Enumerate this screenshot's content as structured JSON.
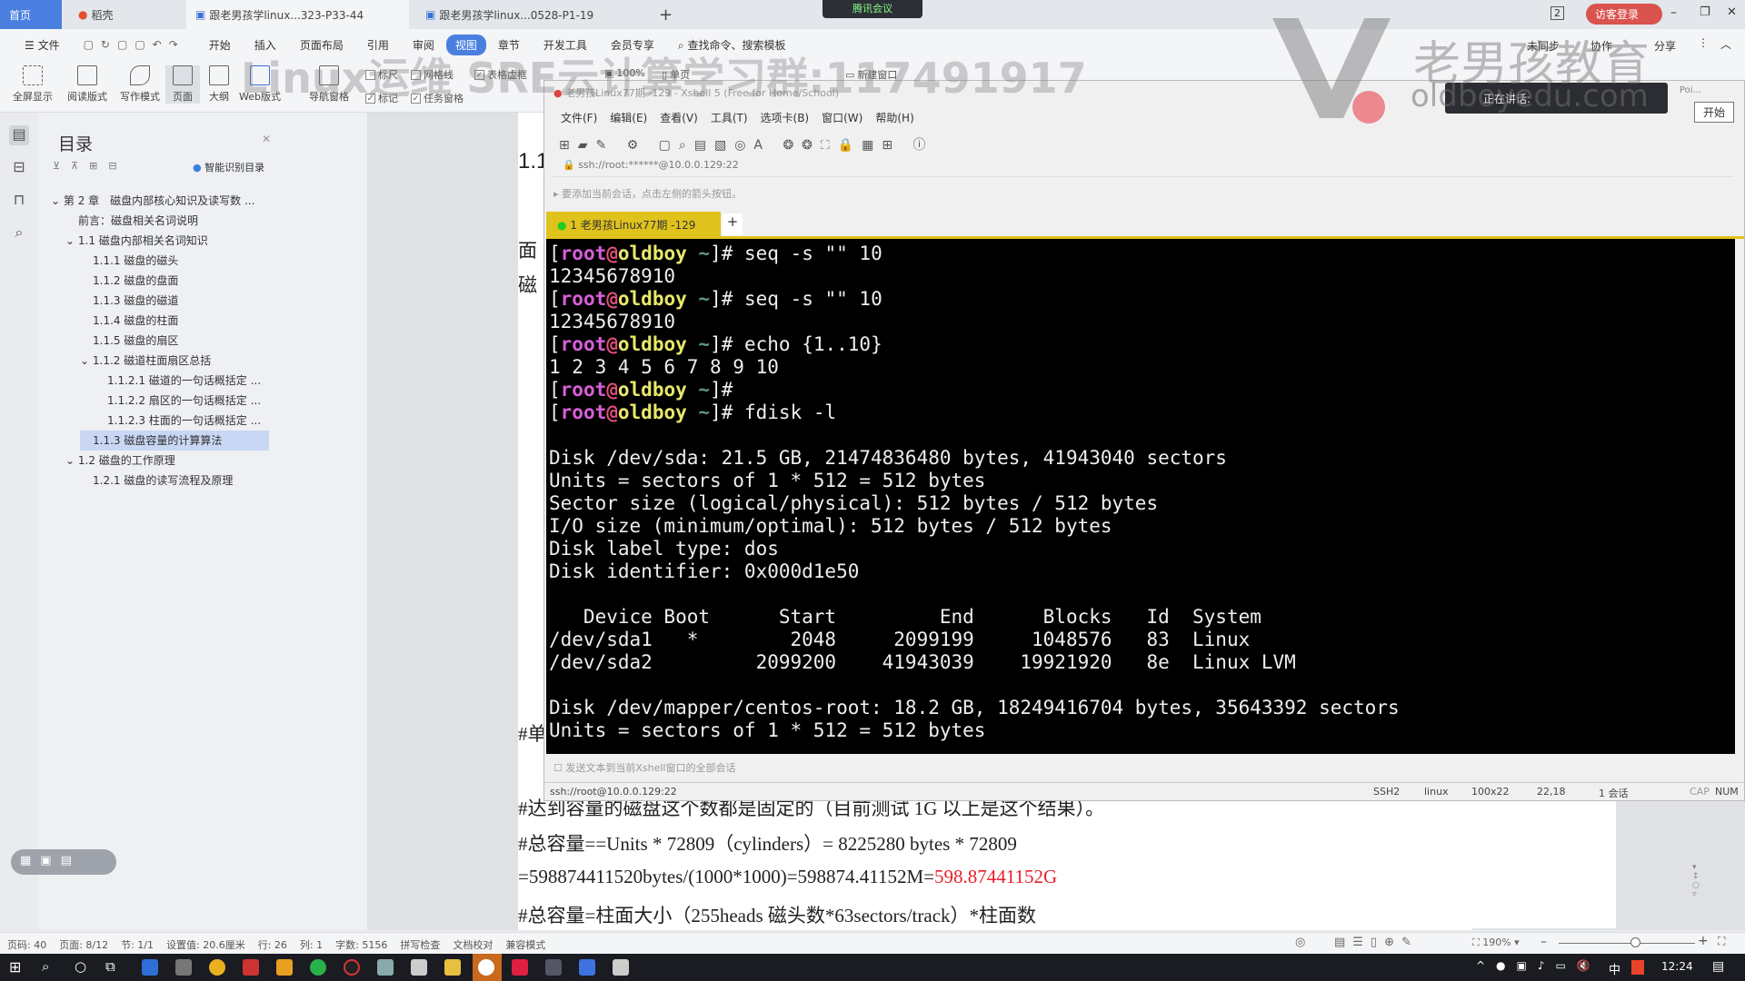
{
  "tabs": [
    {
      "label": "首页",
      "active": true
    },
    {
      "label": "稻壳"
    },
    {
      "label": "跟老男孩学linux...323-P33-44"
    },
    {
      "label": "跟老男孩学linux...0528-P1-19"
    }
  ],
  "tabs_add": "+",
  "window_badge": "2",
  "login_label": "访客登录",
  "menu": [
    "文件",
    "开始",
    "插入",
    "页面布局",
    "引用",
    "审阅",
    "视图",
    "章节",
    "开发工具",
    "会员专享"
  ],
  "menu_active": "视图",
  "search_placeholder": "查找命令、搜索模板",
  "right_actions": [
    "未同步",
    "协作",
    "分享"
  ],
  "ribbon": {
    "buttons": [
      "全屏显示",
      "阅读版式",
      "写作模式",
      "页面",
      "大纲",
      "Web版式",
      "导航窗格"
    ],
    "checks": [
      {
        "label": "标尺",
        "checked": false
      },
      {
        "label": "网格线",
        "checked": false
      },
      {
        "label": "表格虚框",
        "checked": true
      },
      {
        "label": "标记",
        "checked": true
      },
      {
        "label": "任务窗格",
        "checked": true
      }
    ],
    "zoom": "100%",
    "single_page": "单页",
    "new_window": "新建窗口"
  },
  "watermark": {
    "text": "Linux运维 SRE云计算学习群:117491917",
    "brand": "老男孩教育",
    "url": "oldboyedu.com"
  },
  "meeting": {
    "app": "腾讯会议",
    "speaking": "正在讲话:",
    "start": "开始",
    "poi": "Poi..."
  },
  "toc": {
    "title": "目录",
    "smart": "智能识别目录",
    "items": [
      {
        "label": "第 2 章　磁盘内部核心知识及读写数 ...",
        "level": 0,
        "caret": true
      },
      {
        "label": "前言：磁盘相关名词说明",
        "level": 1
      },
      {
        "label": "1.1 磁盘内部相关名词知识",
        "level": 1,
        "caret": true
      },
      {
        "label": "1.1.1 磁盘的磁头",
        "level": 2
      },
      {
        "label": "1.1.2 磁盘的盘面",
        "level": 2
      },
      {
        "label": "1.1.3  磁盘的磁道",
        "level": 2
      },
      {
        "label": "1.1.4  磁盘的柱面",
        "level": 2
      },
      {
        "label": "1.1.5  磁盘的扇区",
        "level": 2
      },
      {
        "label": "1.1.2  磁道柱面扇区总括",
        "level": 2,
        "caret": true
      },
      {
        "label": "1.1.2.1  磁道的一句话概括定 ...",
        "level": 3
      },
      {
        "label": "1.1.2.2  扇区的一句话概括定 ...",
        "level": 3
      },
      {
        "label": "1.1.2.3  柱面的一句话概括定 ...",
        "level": 3
      },
      {
        "label": "1.1.3  磁盘容量的计算算法",
        "level": 2,
        "selected": true
      },
      {
        "label": "1.2 磁盘的工作原理",
        "level": 1,
        "caret": true
      },
      {
        "label": "1.2.1  磁盘的读写流程及原理",
        "level": 2
      }
    ]
  },
  "doc": {
    "heading": "1.1",
    "frag1": "面",
    "frag2": "磁",
    "frag3": "#单",
    "lines": [
      "#达到容量的磁盘这个数都是固定的（目前测试 1G 以上是这个结果）。",
      "#总容量==Units * 72809（cylinders）= 8225280 bytes * 72809"
    ],
    "line3a": "=598874411520bytes/(1000*1000)=598874.41152M=",
    "line3b": "598.87441152G",
    "line4": "#总容量=柱面大小（255heads 磁头数*63sectors/track）*柱面数",
    "highlight": "#e8202a"
  },
  "xshell": {
    "title": "老男孩Linux77期 -129 - Xshell 5 (Free for Home/School)",
    "menu": [
      "文件(F)",
      "编辑(E)",
      "查看(V)",
      "工具(T)",
      "选项卡(B)",
      "窗口(W)",
      "帮助(H)"
    ],
    "address": "ssh://root:******@10.0.0.129:22",
    "hint": "要添加当前会话，点击左侧的箭头按钮。",
    "tab": "1 老男孩Linux77期 -129",
    "tab_add": "+",
    "prompt": {
      "user": "root",
      "at": "@",
      "host": "oldboy",
      "path": "~"
    },
    "lines": [
      {
        "cmd": "seq -s \"\" 10"
      },
      {
        "out": "12345678910"
      },
      {
        "cmd": "seq -s \"\" 10"
      },
      {
        "out": "12345678910"
      },
      {
        "cmd": "echo {1..10}"
      },
      {
        "out": "1 2 3 4 5 6 7 8 9 10"
      },
      {
        "cmd": ""
      },
      {
        "cmd": "fdisk -l"
      },
      {
        "out": ""
      },
      {
        "out": "Disk /dev/sda: 21.5 GB, 21474836480 bytes, 41943040 sectors"
      },
      {
        "out": "Units = sectors of 1 * 512 = 512 bytes"
      },
      {
        "out": "Sector size (logical/physical): 512 bytes / 512 bytes"
      },
      {
        "out": "I/O size (minimum/optimal): 512 bytes / 512 bytes"
      },
      {
        "out": "Disk label type: dos"
      },
      {
        "out": "Disk identifier: 0x000d1e50"
      },
      {
        "out": ""
      },
      {
        "out": "   Device Boot      Start         End      Blocks   Id  System"
      },
      {
        "out": "/dev/sda1   *        2048     2099199     1048576   83  Linux"
      },
      {
        "out": "/dev/sda2         2099200    41943039    19921920   8e  Linux LVM"
      },
      {
        "out": ""
      },
      {
        "out": "Disk /dev/mapper/centos-root: 18.2 GB, 18249416704 bytes, 35643392 sectors"
      },
      {
        "out": "Units = sectors of 1 * 512 = 512 bytes"
      }
    ],
    "send_bar": "发送文本到当前Xshell窗口的全部会话",
    "status": {
      "conn": "ssh://root@10.0.0.129:22",
      "proto": "SSH2",
      "term": "linux",
      "size": "100x22",
      "pos": "22,18",
      "sessions": "1 会话",
      "caps": "CAP",
      "num": "NUM"
    }
  },
  "status": {
    "items": [
      "页码: 40",
      "页面: 8/12",
      "节: 1/1",
      "设置值: 20.6厘米",
      "行: 26",
      "列: 1",
      "字数: 5156",
      "拼写检查",
      "文档校对",
      "兼容模式"
    ],
    "zoom": "190%"
  },
  "taskbar": {
    "clock": "12:24",
    "ime": "中"
  }
}
